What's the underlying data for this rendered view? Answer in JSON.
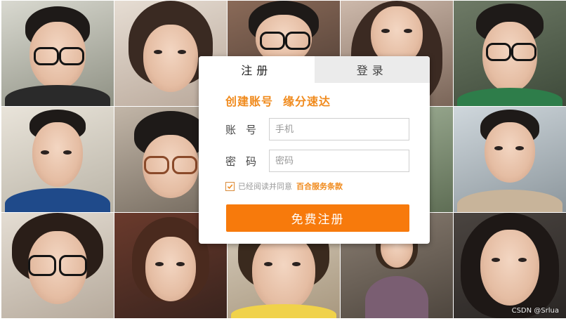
{
  "tabs": [
    {
      "label": "注册"
    },
    {
      "label": "登录"
    }
  ],
  "slogan": {
    "part1": "创建账号",
    "part2": "缘分速达"
  },
  "account": {
    "label": "账号",
    "placeholder": "手机"
  },
  "password": {
    "label": "密码",
    "placeholder": "密码"
  },
  "agreement": {
    "text": "已经阅读并同意",
    "link": "百合服务条款",
    "checked": true
  },
  "submit": {
    "label": "免费注册"
  },
  "watermark": "CSDN @Srlua",
  "colors": {
    "accent": "#f77a0c",
    "slogan": "#f08a1c",
    "inactive_tab": "#ebebeb"
  }
}
